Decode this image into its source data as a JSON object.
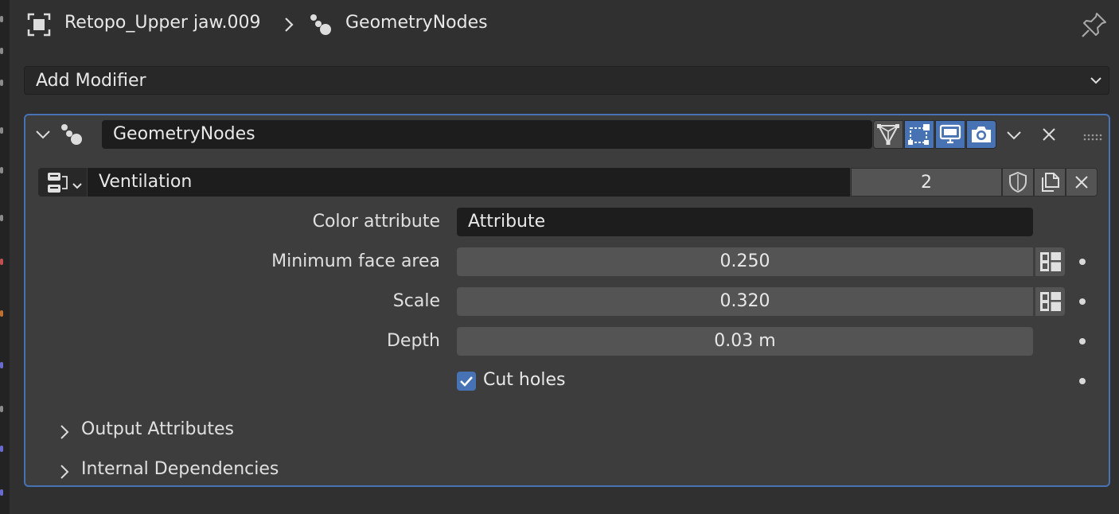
{
  "header": {
    "object_name": "Retopo_Upper jaw.009",
    "modifier_name": "GeometryNodes",
    "icons": {
      "object": "object-bounds-icon",
      "separator": "chevron-right-icon",
      "modifier": "geometry-nodes-icon",
      "pin": "pin-icon"
    }
  },
  "add_modifier": {
    "label": "Add Modifier",
    "icon": "chevron-down-icon"
  },
  "modifier": {
    "name": "GeometryNodes",
    "toggles": [
      {
        "name": "edit-cage-icon",
        "active": false
      },
      {
        "name": "edit-mode-icon",
        "active": true
      },
      {
        "name": "viewport-display-icon",
        "active": true
      },
      {
        "name": "render-camera-icon",
        "active": true
      }
    ],
    "node_group": {
      "name": "Ventilation",
      "users": "2"
    },
    "properties": {
      "color_attribute": {
        "label": "Color attribute",
        "value": "Attribute"
      },
      "min_face_area": {
        "label": "Minimum face area",
        "value": "0.250"
      },
      "scale": {
        "label": "Scale",
        "value": "0.320"
      },
      "depth": {
        "label": "Depth",
        "value": "0.03 m"
      },
      "cut_holes": {
        "label": "Cut holes",
        "checked": true
      }
    },
    "subpanels": [
      {
        "label": "Output Attributes"
      },
      {
        "label": "Internal Dependencies"
      }
    ]
  },
  "colors": {
    "accent": "#4772b3",
    "background": "#303030",
    "panel": "#3d3d3d",
    "field_dark": "#1d1d1d",
    "field_numeric": "#545454"
  }
}
